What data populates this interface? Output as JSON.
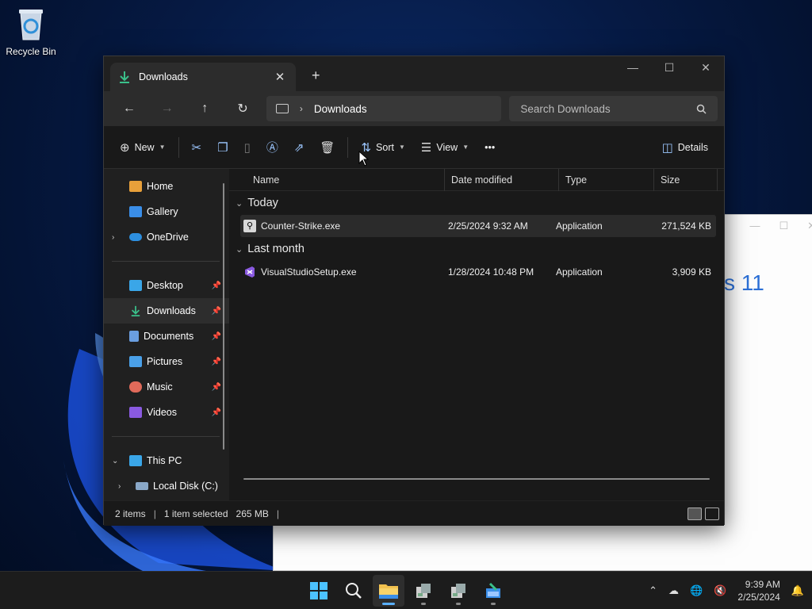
{
  "desktop": {
    "recycle_bin_label": "Recycle Bin"
  },
  "bg_window": {
    "partial_text": "s 11"
  },
  "explorer": {
    "tab_title": "Downloads",
    "tab_close": "✕",
    "new_tab": "+",
    "window_controls": {
      "minimize": "—",
      "maximize": "☐",
      "close": "✕"
    },
    "nav": {
      "back": "←",
      "forward": "→",
      "up": "↑",
      "refresh": "↻"
    },
    "breadcrumb": "Downloads",
    "search_placeholder": "Search Downloads",
    "commands": {
      "new": "New",
      "sort": "Sort",
      "view": "View",
      "more": "•••",
      "details": "Details"
    },
    "sidebar": {
      "top": [
        {
          "label": "Home",
          "color": "#e8a03a"
        },
        {
          "label": "Gallery",
          "color": "#3a8ee8"
        },
        {
          "label": "OneDrive",
          "color": "#2d8fe0"
        }
      ],
      "pinned": [
        {
          "label": "Desktop",
          "color": "#3aa6e8"
        },
        {
          "label": "Downloads",
          "color": "#3ac08a"
        },
        {
          "label": "Documents",
          "color": "#6a9ee0"
        },
        {
          "label": "Pictures",
          "color": "#4aa0e8"
        },
        {
          "label": "Music",
          "color": "#e06a5a"
        },
        {
          "label": "Videos",
          "color": "#8a5ae0"
        }
      ],
      "this_pc": "This PC",
      "local_disk": "Local Disk (C:)"
    },
    "columns": {
      "name": "Name",
      "date": "Date modified",
      "type": "Type",
      "size": "Size"
    },
    "groups": [
      {
        "label": "Today",
        "files": [
          {
            "name": "Counter-Strike.exe",
            "date": "2/25/2024 9:32 AM",
            "type": "Application",
            "size": "271,524 KB"
          }
        ]
      },
      {
        "label": "Last month",
        "files": [
          {
            "name": "VisualStudioSetup.exe",
            "date": "1/28/2024 10:48 PM",
            "type": "Application",
            "size": "3,909 KB"
          }
        ]
      }
    ],
    "status": {
      "items": "2 items",
      "selected": "1 item selected",
      "size": "265 MB"
    }
  },
  "taskbar": {
    "time": "9:39 AM",
    "date": "2/25/2024"
  }
}
